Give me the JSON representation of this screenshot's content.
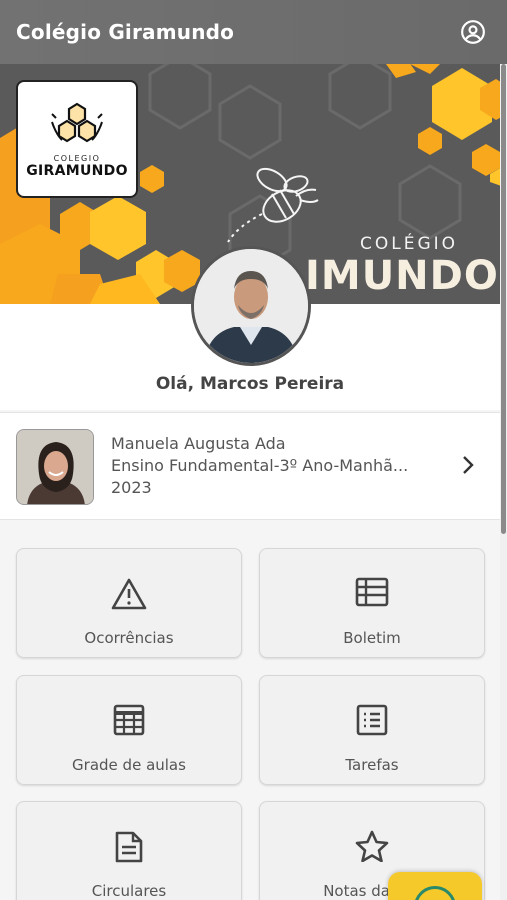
{
  "app": {
    "title": "Colégio Giramundo",
    "user_icon": "account-circle-icon"
  },
  "banner": {
    "logo_small": "COLEGIO",
    "logo_big": "GIRAMUNDO",
    "text_small": "COLÉGIO",
    "text_big": "IMUNDO",
    "colors": {
      "background": "#5a5a5a",
      "honey": "#f5a623",
      "honey_light": "#ffcc33"
    }
  },
  "profile": {
    "greeting": "Olá, Marcos Pereira"
  },
  "student": {
    "name": "Manuela Augusta Ada",
    "class": "Ensino Fundamental-3º Ano-Manhã...",
    "year": "2023"
  },
  "menu": [
    {
      "label": "Ocorrências",
      "icon": "warning-icon"
    },
    {
      "label": "Boletim",
      "icon": "list-icon"
    },
    {
      "label": "Grade de aulas",
      "icon": "calendar-grid-icon"
    },
    {
      "label": "Tarefas",
      "icon": "checklist-icon"
    },
    {
      "label": "Circulares",
      "icon": "document-icon"
    },
    {
      "label": "Notas das Av",
      "icon": "star-icon"
    }
  ],
  "colors": {
    "appbar": "#6e6e6e",
    "fab": "#f6c92b"
  }
}
